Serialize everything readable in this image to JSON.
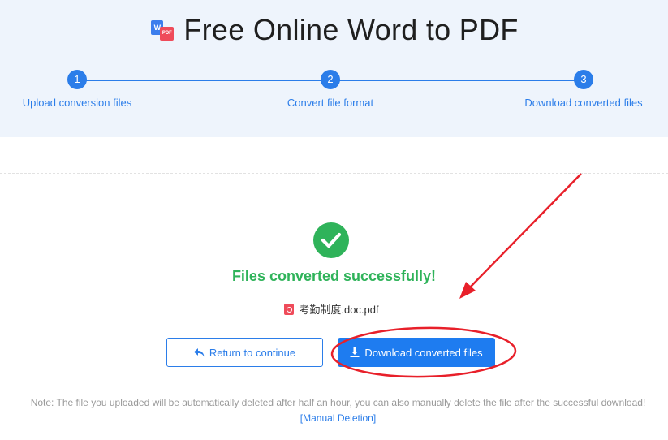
{
  "header": {
    "title": "Free Online Word to PDF",
    "logo_word_letter": "W",
    "logo_pdf_letter": "PDF"
  },
  "steps": [
    {
      "number": "1",
      "label": "Upload conversion files"
    },
    {
      "number": "2",
      "label": "Convert file format"
    },
    {
      "number": "3",
      "label": "Download converted files"
    }
  ],
  "result": {
    "message": "Files converted successfully!",
    "file_name": "考勤制度.doc.pdf"
  },
  "actions": {
    "return_label": "Return to continue",
    "download_label": "Download converted files"
  },
  "footer": {
    "note": "Note: The file you uploaded will be automatically deleted after half an hour, you can also manually delete the file after the successful download!",
    "manual_deletion_link": "[Manual Deletion]"
  },
  "colors": {
    "accent": "#2b7de9",
    "success": "#2fb35a",
    "pdf_red": "#ef4b5a",
    "annotation_red": "#e8202a",
    "header_bg": "#eef4fc"
  },
  "icons": {
    "logo": "word-to-pdf-logo-icon",
    "success": "check-circle-icon",
    "file": "pdf-file-icon",
    "return": "reply-arrow-icon",
    "download": "download-icon"
  }
}
